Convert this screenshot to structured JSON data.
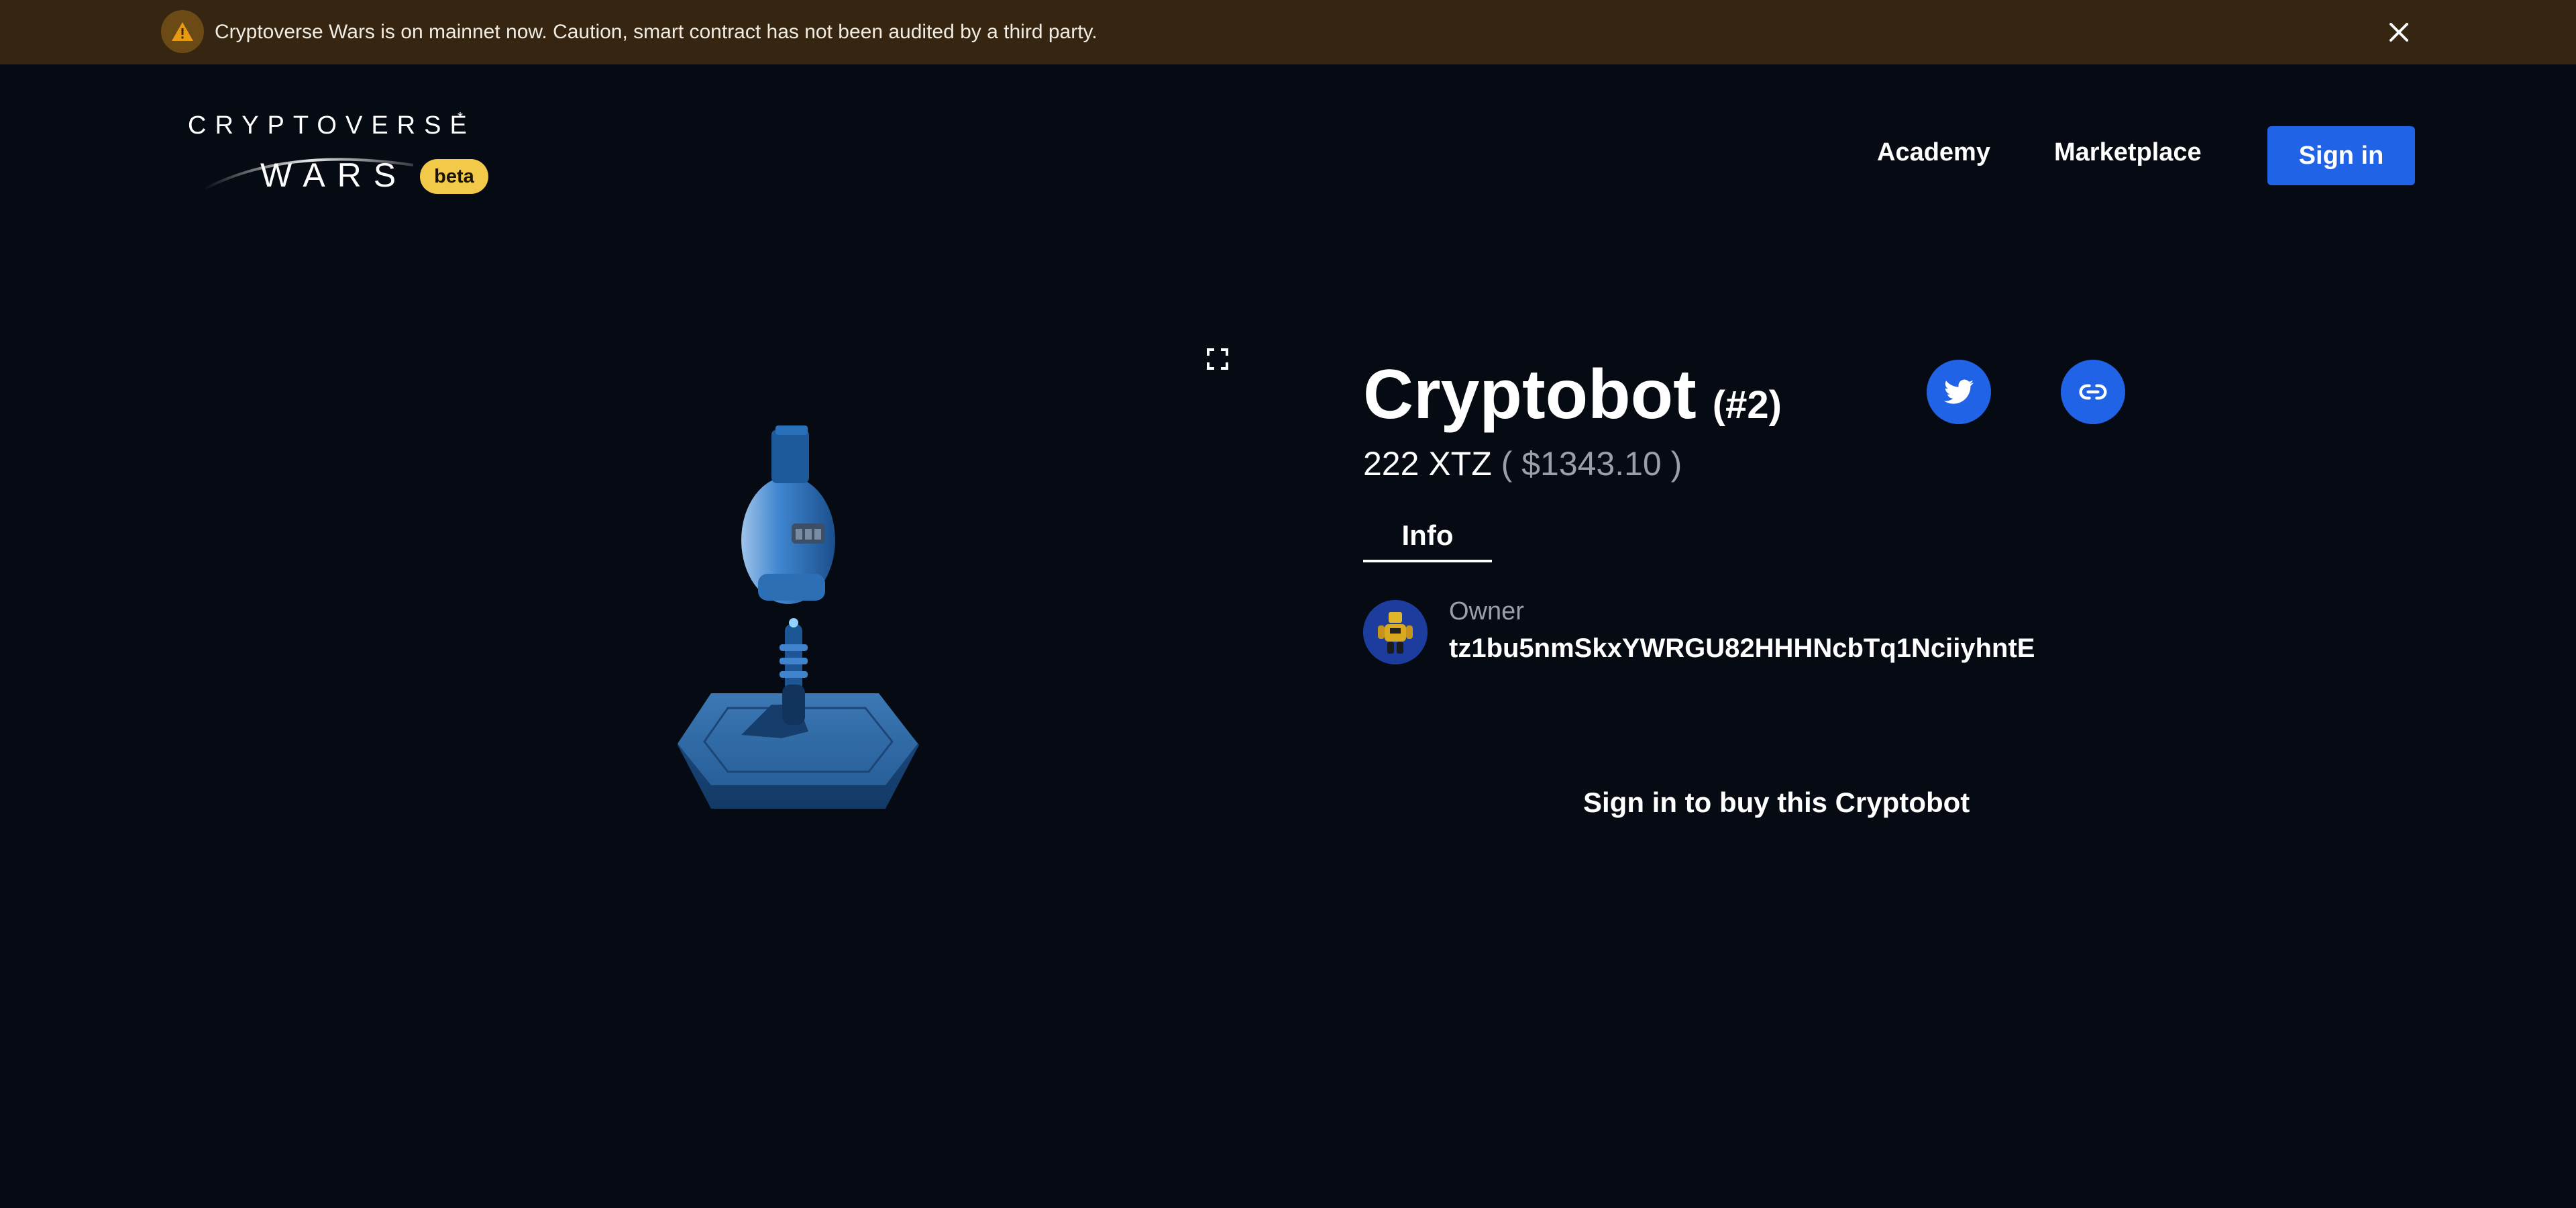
{
  "banner": {
    "icon": "warning-icon",
    "text": "Cryptoverse Wars is on mainnet now. Caution, smart contract has not been audited by a third party.",
    "close_icon": "close-icon"
  },
  "logo": {
    "line1": "CRYPTOVERSE",
    "star": "*",
    "line2": "WARS",
    "badge": "beta"
  },
  "nav": {
    "academy": "Academy",
    "marketplace": "Marketplace",
    "signin": "Sign in"
  },
  "item": {
    "name": "Cryptobot",
    "number": "(#2)",
    "price_xtz": "222 XTZ",
    "price_usd": "( $1343.10 )",
    "tab": "Info",
    "owner_label": "Owner",
    "owner_address": "tz1bu5nmSkxYWRGU82HHHNcbTq1NciiyhntE",
    "buy_prompt": "Sign in to buy this Cryptobot"
  },
  "colors": {
    "background": "#060a12",
    "banner": "#362611",
    "accent": "#2163e6",
    "badge": "#f3c94a"
  }
}
